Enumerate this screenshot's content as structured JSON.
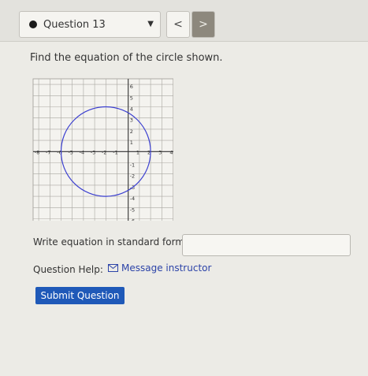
{
  "header": {
    "question_label": "Question 13",
    "prev_glyph": "<",
    "next_glyph": ">"
  },
  "prompt": "Find the equation of the circle shown.",
  "graph": {
    "x_ticks": [
      "-8",
      "-7",
      "-6",
      "-5",
      "-4",
      "-3",
      "-2",
      "-1",
      "1",
      "2",
      "3",
      "4"
    ],
    "y_ticks": [
      "6",
      "5",
      "4",
      "3",
      "2",
      "1",
      "-1",
      "-2",
      "-3",
      "-4",
      "-5",
      "-6"
    ],
    "x_range": [
      -8,
      4
    ],
    "y_range": [
      -6,
      6
    ],
    "circle": {
      "center": [
        -2,
        0
      ],
      "radius": 4
    },
    "circle_color": "#3b3fd0",
    "zoom_icon": "magnifier-icon"
  },
  "answer": {
    "label": "Write equation in standard form:",
    "placeholder": ""
  },
  "help": {
    "label": "Question Help:",
    "link_icon": "mail-icon",
    "link_label": "Message instructor"
  },
  "submit_label": "Submit Question",
  "colors": {
    "submit": "#1f59b8",
    "link": "#2c43a8"
  }
}
